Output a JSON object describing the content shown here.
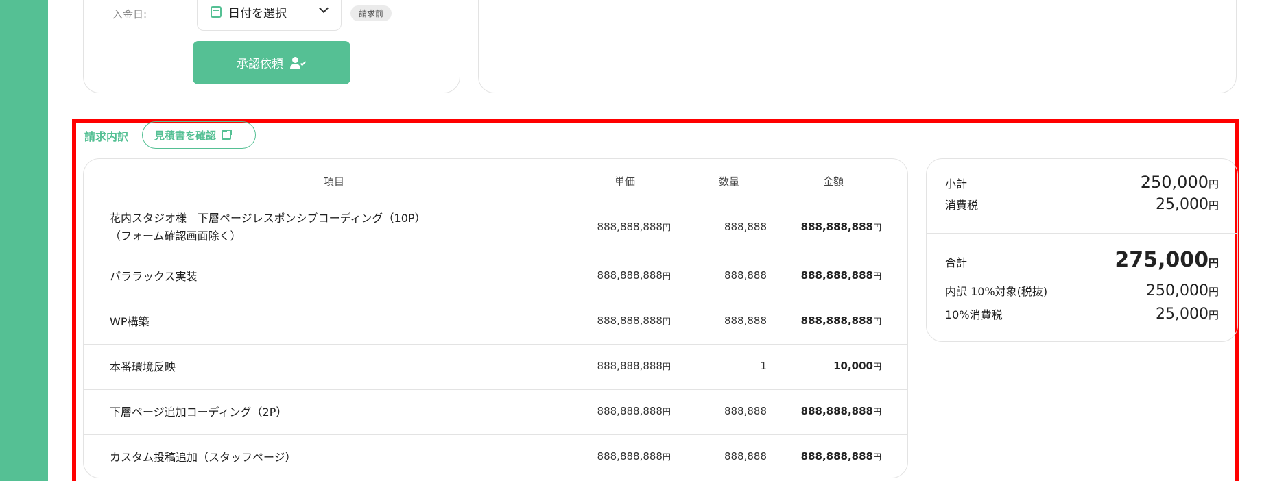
{
  "form": {
    "payment_date_label": "入金日:",
    "date_select_value": "日付を選択",
    "status_badge": "請求前",
    "approve_button": "承認依頼"
  },
  "breakdown": {
    "title": "請求内訳",
    "estimate_button": "見積書を確認"
  },
  "table": {
    "headers": {
      "item": "項目",
      "unit_price": "単価",
      "quantity": "数量",
      "amount": "金額"
    },
    "rows": [
      {
        "name_line1": "花内スタジオ様　下層ページレスポンシブコーディング（10P）",
        "name_line2": "（フォーム確認画面除く）",
        "unit_price": "888,888,888",
        "quantity": "888,888",
        "amount": "888,888,888"
      },
      {
        "name_line1": "パララックス実装",
        "unit_price": "888,888,888",
        "quantity": "888,888",
        "amount": "888,888,888"
      },
      {
        "name_line1": "WP構築",
        "unit_price": "888,888,888",
        "quantity": "888,888",
        "amount": "888,888,888"
      },
      {
        "name_line1": "本番環境反映",
        "unit_price": "888,888,888",
        "quantity": "1",
        "amount": "10,000"
      },
      {
        "name_line1": "下層ページ追加コーディング（2P）",
        "unit_price": "888,888,888",
        "quantity": "888,888",
        "amount": "888,888,888"
      },
      {
        "name_line1": "カスタム投稿追加（スタッフページ）",
        "unit_price": "888,888,888",
        "quantity": "888,888",
        "amount": "888,888,888"
      }
    ],
    "yen": "円"
  },
  "summary": {
    "subtotal_label": "小計",
    "subtotal": "250,000",
    "tax_label": "消費税",
    "tax": "25,000",
    "total_label": "合計",
    "total": "275,000",
    "breakdown_label": "内訳 10%対象(税抜)",
    "breakdown_value": "250,000",
    "tax10_label": "10%消費税",
    "tax10_value": "25,000",
    "yen": "円"
  },
  "colors": {
    "accent": "#55c094",
    "highlight_frame": "#ff0000"
  },
  "icons": {
    "calendar": "calendar-icon",
    "chevron": "chevron-down-icon",
    "user_check": "user-check-icon",
    "external_link": "external-link-icon"
  }
}
